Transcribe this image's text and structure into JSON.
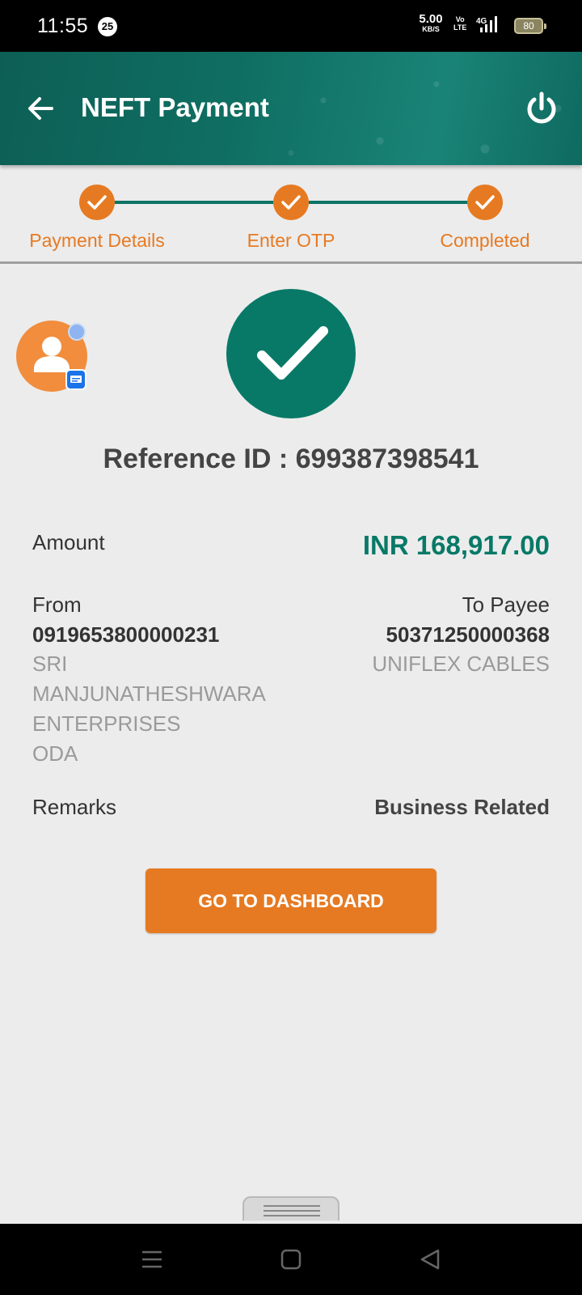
{
  "status_bar": {
    "time": "11:55",
    "notification_count": "25",
    "net_speed": "5.00",
    "net_speed_unit": "KB/S",
    "volte_top": "Vo",
    "volte_bottom": "LTE",
    "network": "4G",
    "battery": "80"
  },
  "header": {
    "title": "NEFT Payment",
    "back_icon": "arrow-left-icon",
    "power_icon": "power-icon"
  },
  "stepper": {
    "steps": [
      {
        "label": "Payment Details",
        "done": true
      },
      {
        "label": "Enter OTP",
        "done": true
      },
      {
        "label": "Completed",
        "done": true
      }
    ]
  },
  "result": {
    "reference_line": "Reference ID : 699387398541"
  },
  "details": {
    "amount_label": "Amount",
    "amount_value": "INR 168,917.00",
    "from_label": "From",
    "from_account": "0919653800000231",
    "from_name_lines": [
      "SRI",
      "MANJUNATHESHWARA",
      "ENTERPRISES",
      "ODA"
    ],
    "to_label": "To Payee",
    "to_account": "50371250000368",
    "to_name": "UNIFLEX CABLES",
    "remarks_label": "Remarks",
    "remarks_value": "Business Related"
  },
  "actions": {
    "dashboard_button": "GO TO DASHBOARD"
  },
  "colors": {
    "primary_teal": "#087967",
    "accent_orange": "#e67a22"
  }
}
